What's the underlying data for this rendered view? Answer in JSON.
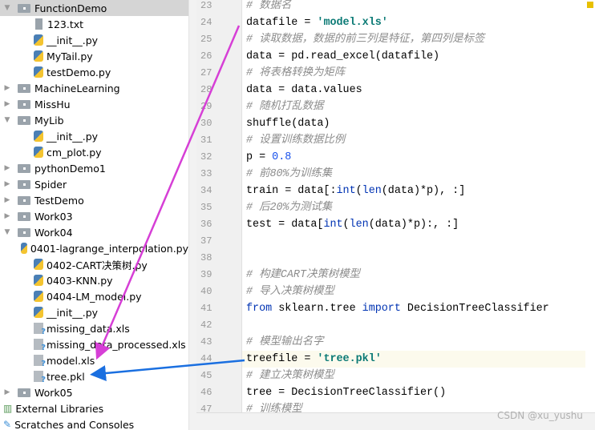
{
  "tree": [
    {
      "label": "FunctionDemo",
      "type": "folder",
      "expanded": true,
      "depth": 0,
      "selected": true
    },
    {
      "label": "123.txt",
      "type": "txt",
      "depth": 1
    },
    {
      "label": "__init__.py",
      "type": "py",
      "depth": 1
    },
    {
      "label": "MyTail.py",
      "type": "py",
      "depth": 1
    },
    {
      "label": "testDemo.py",
      "type": "py",
      "depth": 1
    },
    {
      "label": "MachineLearning",
      "type": "folder",
      "expanded": false,
      "depth": 0
    },
    {
      "label": "MissHu",
      "type": "folder",
      "expanded": false,
      "depth": 0
    },
    {
      "label": "MyLib",
      "type": "folder",
      "expanded": true,
      "depth": 0
    },
    {
      "label": "__init__.py",
      "type": "py",
      "depth": 1
    },
    {
      "label": "cm_plot.py",
      "type": "py",
      "depth": 1
    },
    {
      "label": "pythonDemo1",
      "type": "folder",
      "expanded": false,
      "depth": 0
    },
    {
      "label": "Spider",
      "type": "folder",
      "expanded": false,
      "depth": 0
    },
    {
      "label": "TestDemo",
      "type": "folder",
      "expanded": false,
      "depth": 0
    },
    {
      "label": "Work03",
      "type": "folder",
      "expanded": false,
      "depth": 0
    },
    {
      "label": "Work04",
      "type": "folder",
      "expanded": true,
      "depth": 0
    },
    {
      "label": "0401-lagrange_interpolation.py",
      "type": "py",
      "depth": 1
    },
    {
      "label": "0402-CART决策树.py",
      "type": "py",
      "depth": 1
    },
    {
      "label": "0403-KNN.py",
      "type": "py",
      "depth": 1
    },
    {
      "label": "0404-LM_model.py",
      "type": "py",
      "depth": 1
    },
    {
      "label": "__init__.py",
      "type": "py",
      "depth": 1
    },
    {
      "label": "missing_data.xls",
      "type": "unknown",
      "depth": 1
    },
    {
      "label": "missing_data_processed.xls",
      "type": "unknown",
      "depth": 1
    },
    {
      "label": "model.xls",
      "type": "unknown",
      "depth": 1
    },
    {
      "label": "tree.pkl",
      "type": "unknown",
      "depth": 1
    },
    {
      "label": "Work05",
      "type": "folder",
      "expanded": false,
      "depth": 0
    },
    {
      "label": "External Libraries",
      "type": "libs",
      "depth": -1
    },
    {
      "label": "Scratches and Consoles",
      "type": "scratch",
      "depth": -1
    }
  ],
  "code": [
    {
      "n": "23",
      "parts": [
        [
          "cm",
          "# 数据名"
        ]
      ]
    },
    {
      "n": "24",
      "parts": [
        [
          "",
          "datafile = "
        ],
        [
          "str",
          "'model.xls'"
        ]
      ]
    },
    {
      "n": "25",
      "parts": [
        [
          "cm",
          "# 读取数据，数据的前三列是特征，第四列是标签"
        ]
      ]
    },
    {
      "n": "26",
      "parts": [
        [
          "",
          "data = pd.read_excel(datafile)"
        ]
      ]
    },
    {
      "n": "27",
      "parts": [
        [
          "cm",
          "# 将表格转换为矩阵"
        ]
      ]
    },
    {
      "n": "28",
      "parts": [
        [
          "",
          "data = data.values"
        ]
      ]
    },
    {
      "n": "29",
      "parts": [
        [
          "cm",
          "# 随机打乱数据"
        ]
      ]
    },
    {
      "n": "30",
      "parts": [
        [
          "",
          "shuffle(data)"
        ]
      ]
    },
    {
      "n": "31",
      "parts": [
        [
          "cm",
          "# 设置训练数据比例"
        ]
      ]
    },
    {
      "n": "32",
      "parts": [
        [
          "",
          "p = "
        ],
        [
          "num",
          "0.8"
        ]
      ]
    },
    {
      "n": "33",
      "parts": [
        [
          "cm",
          "# 前80%为训练集"
        ]
      ]
    },
    {
      "n": "34",
      "parts": [
        [
          "",
          "train = data[:"
        ],
        [
          "kw",
          "int"
        ],
        [
          "",
          "("
        ],
        [
          "kw",
          "len"
        ],
        [
          "",
          "(data)*p), :]"
        ]
      ]
    },
    {
      "n": "35",
      "parts": [
        [
          "cm",
          "# 后20%为测试集"
        ]
      ]
    },
    {
      "n": "36",
      "parts": [
        [
          "",
          "test = data["
        ],
        [
          "kw",
          "int"
        ],
        [
          "",
          "("
        ],
        [
          "kw",
          "len"
        ],
        [
          "",
          "(data)*p):, :]"
        ]
      ]
    },
    {
      "n": "37",
      "parts": []
    },
    {
      "n": "38",
      "parts": []
    },
    {
      "n": "39",
      "parts": [
        [
          "cm",
          "# 构建CART决策树模型"
        ]
      ]
    },
    {
      "n": "40",
      "parts": [
        [
          "cm",
          "# 导入决策树模型"
        ]
      ]
    },
    {
      "n": "41",
      "parts": [
        [
          "kw",
          "from"
        ],
        [
          "",
          " sklearn.tree "
        ],
        [
          "kw",
          "import"
        ],
        [
          "",
          " DecisionTreeClassifier"
        ]
      ]
    },
    {
      "n": "42",
      "parts": []
    },
    {
      "n": "43",
      "parts": [
        [
          "cm",
          "# 模型输出名字"
        ]
      ]
    },
    {
      "n": "44",
      "parts": [
        [
          "",
          "treefile = "
        ],
        [
          "str",
          "'tree.pkl'"
        ]
      ],
      "current": true
    },
    {
      "n": "45",
      "parts": [
        [
          "cm",
          "# 建立决策树模型"
        ]
      ]
    },
    {
      "n": "46",
      "parts": [
        [
          "",
          "tree = DecisionTreeClassifier()"
        ]
      ]
    },
    {
      "n": "47",
      "parts": [
        [
          "cm",
          "# 训练模型"
        ]
      ]
    }
  ],
  "watermark": "CSDN @xu_yushu",
  "colors": {
    "arrow_magenta": "#d63fd6",
    "arrow_blue": "#1a6fe0"
  }
}
